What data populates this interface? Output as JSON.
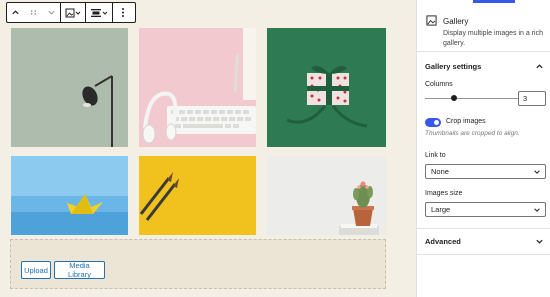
{
  "toolbar": {
    "buttons": [
      {
        "name": "block-type",
        "icon": "chevron-up-icon"
      },
      {
        "name": "drag-handle",
        "icon": "drag-handle-icon"
      },
      {
        "name": "move-down",
        "icon": "chevron-down-icon"
      },
      {
        "name": "change-block-type",
        "icon": "gallery-icon"
      },
      {
        "name": "align",
        "icon": "align-icon"
      },
      {
        "name": "more-options",
        "icon": "more-vertical-icon"
      }
    ]
  },
  "gallery": {
    "images": [
      {
        "subject": "desk lamp",
        "bg": "#a9b8a9"
      },
      {
        "subject": "headphones and keyboard",
        "bg": "#f2c9cf"
      },
      {
        "subject": "gift box",
        "bg": "#2e7a52"
      },
      {
        "subject": "paper boat",
        "bg": "#6ab6e6"
      },
      {
        "subject": "pencils",
        "bg": "#f1c21d"
      },
      {
        "subject": "cactus",
        "bg": "#ececea"
      }
    ]
  },
  "upload": {
    "upload_label": "Upload",
    "media_library_label": "Media Library"
  },
  "sidebar": {
    "block": {
      "title": "Gallery",
      "description": "Display multiple images in a rich gallery.",
      "icon": "gallery-icon"
    },
    "gallery_settings": {
      "title": "Gallery settings",
      "columns_label": "Columns",
      "columns_value": "3",
      "columns_slider_value": 3,
      "columns_slider_max": 8,
      "crop_label": "Crop images",
      "crop_enabled": true,
      "crop_help": "Thumbnails are cropped to align.",
      "link_to_label": "Link to",
      "link_to_value": "None",
      "images_size_label": "Images size",
      "images_size_value": "Large"
    },
    "advanced": {
      "title": "Advanced"
    }
  },
  "colors": {
    "accent": "#3858e9",
    "button_blue": "#2271b1",
    "canvas_bg": "#f4efe5"
  }
}
